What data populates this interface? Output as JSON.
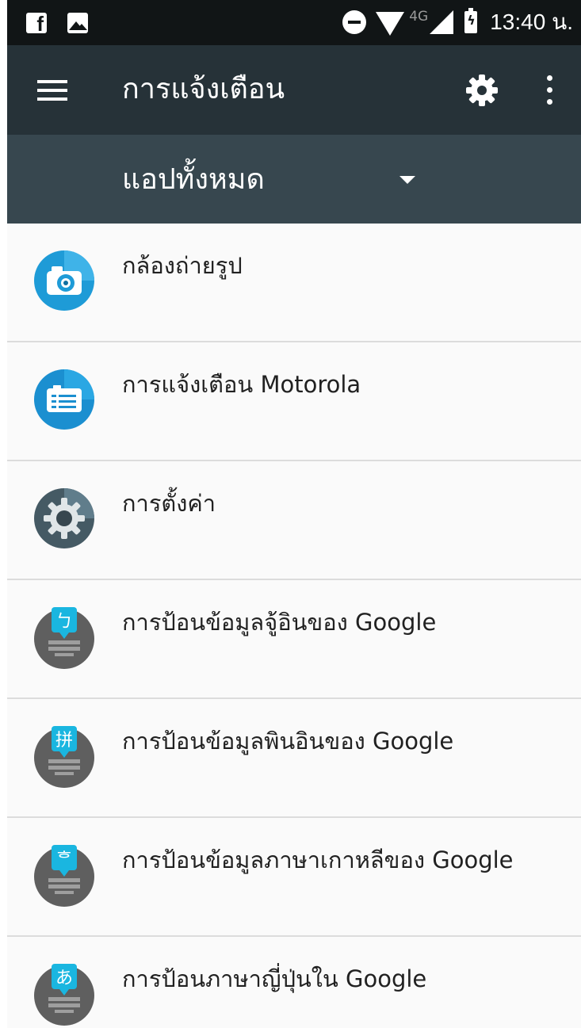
{
  "status_bar": {
    "network_type": "4G",
    "battery_glyph": "ϟ",
    "time": "13:40 น.",
    "icons": [
      "facebook-icon",
      "image-icon",
      "do-not-disturb-icon",
      "wifi-icon",
      "signal-icon",
      "battery-charging-icon"
    ]
  },
  "toolbar": {
    "title": "การแจ้งเตือน",
    "icons": [
      "menu-icon",
      "gear-icon",
      "more-options-icon"
    ]
  },
  "filter": {
    "selected": "แอปทั้งหมด"
  },
  "apps": [
    {
      "name": "กล้องถ่ายรูป",
      "icon": "camera-app-icon"
    },
    {
      "name": "การแจ้งเตือน Motorola",
      "icon": "motorola-notification-app-icon"
    },
    {
      "name": "การตั้งค่า",
      "icon": "settings-app-icon"
    },
    {
      "name": "การป้อนข้อมูลจู้อินของ Google",
      "icon": "zhuyin-keyboard-app-icon",
      "glyph": "ㄅ"
    },
    {
      "name": "การป้อนข้อมูลพินอินของ Google",
      "icon": "pinyin-keyboard-app-icon",
      "glyph": "拼"
    },
    {
      "name": "การป้อนข้อมูลภาษาเกาหลีของ Google",
      "icon": "korean-keyboard-app-icon",
      "glyph": "ᄒ"
    },
    {
      "name": "การป้อนภาษาญี่ปุ่นใน Google",
      "icon": "japanese-keyboard-app-icon",
      "glyph": "あ"
    }
  ],
  "colors": {
    "status_bar": "#111516",
    "toolbar": "#263238",
    "filter_bar": "#37474f",
    "list_background": "#fafafa",
    "divider": "#dcdcdc",
    "keyboard_accent": "#1ab6e0"
  }
}
